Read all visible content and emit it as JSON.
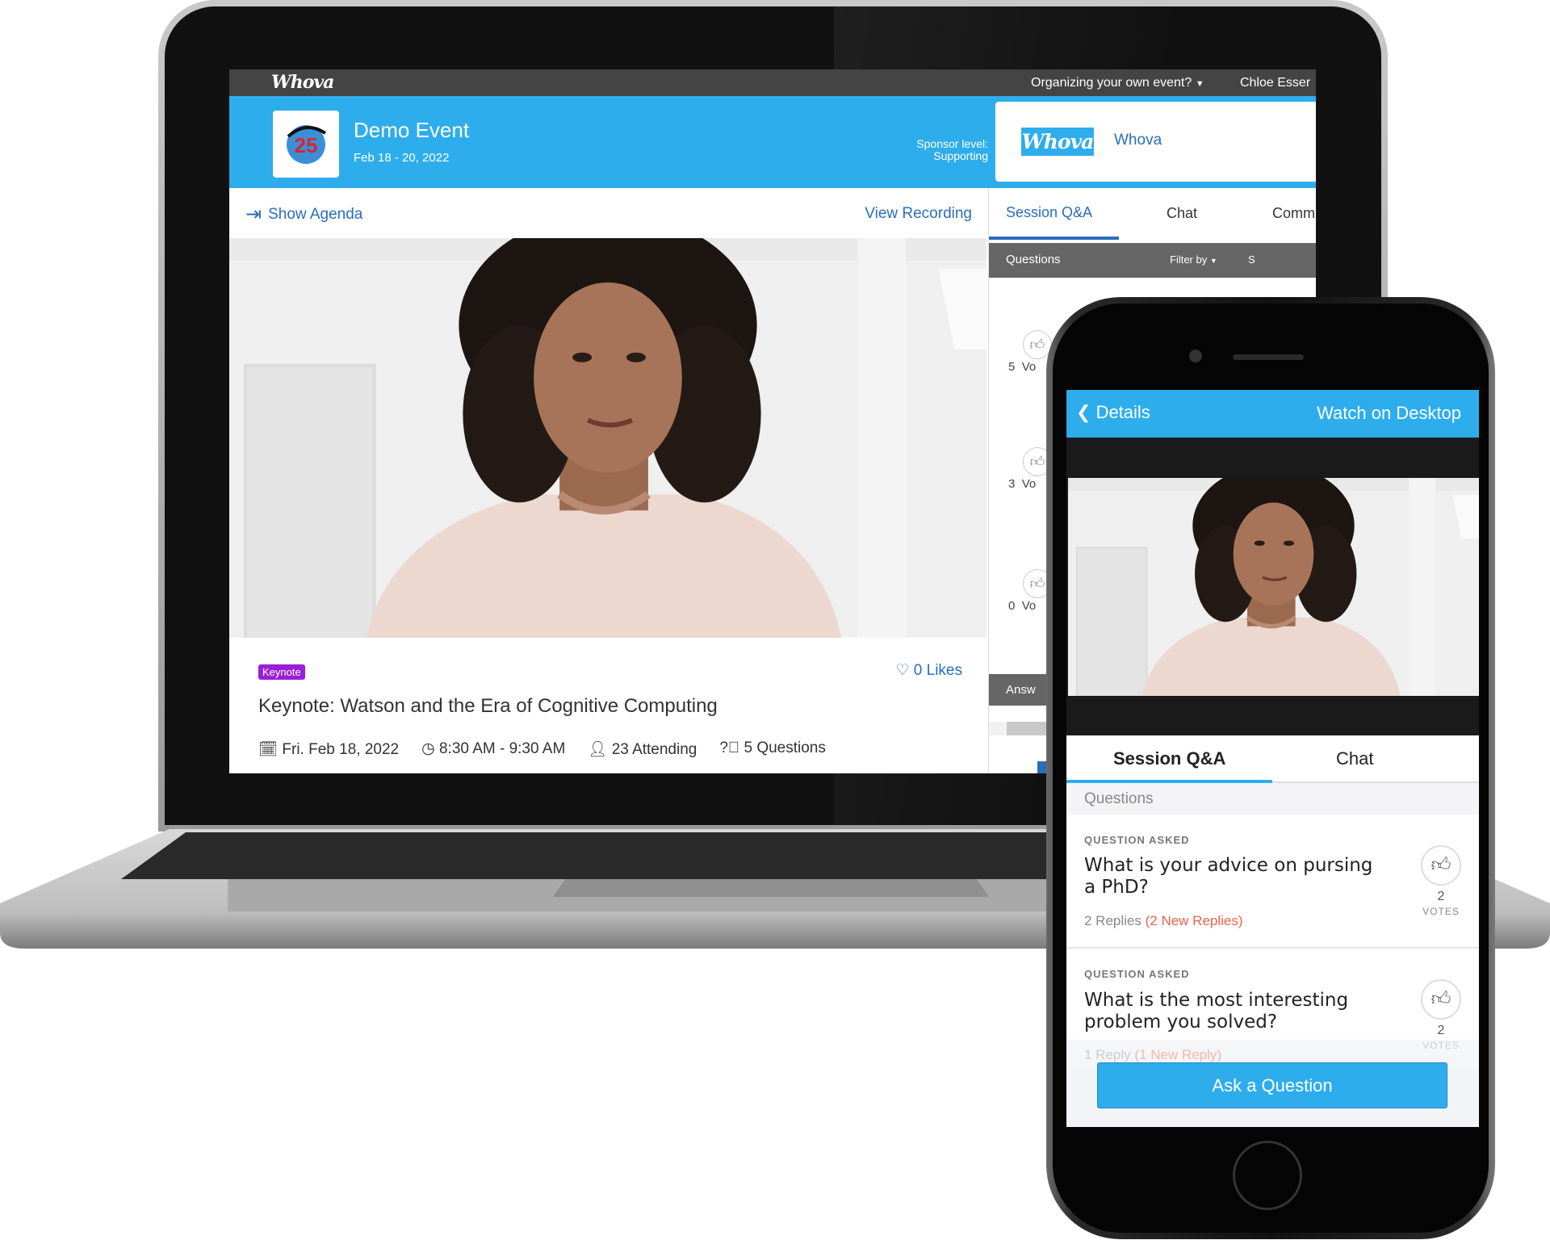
{
  "laptop": {
    "topbar": {
      "logo": "Whova",
      "organizing": "Organizing your own event?",
      "user": "Chloe Esser"
    },
    "header": {
      "event_title": "Demo Event",
      "event_dates": "Feb 18 - 20, 2022",
      "sponsor_label": "Sponsor level:",
      "sponsor_level": "Supporting",
      "sponsor_logo": "Whova",
      "sponsor_name": "Whova"
    },
    "nav": {
      "show_agenda": "Show Agenda",
      "view_recording": "View Recording"
    },
    "tabs": [
      {
        "label": "Session Q&A",
        "active": true
      },
      {
        "label": "Chat"
      },
      {
        "label": "Comm"
      }
    ],
    "questions_bar": {
      "title": "Questions",
      "filter": "Filter by",
      "extra": "S"
    },
    "votes": [
      {
        "count": "5",
        "label": "Vo"
      },
      {
        "count": "3",
        "label": "Vo"
      },
      {
        "count": "0",
        "label": "Vo"
      }
    ],
    "answered_bar": "Answ",
    "session": {
      "badge": "Keynote",
      "likes": "0 Likes",
      "title": "Keynote: Watson and the Era of Cognitive Computing",
      "date": "Fri. Feb 18, 2022",
      "time": "8:30 AM - 9:30 AM",
      "attending": "23 Attending",
      "questions": "5 Questions"
    }
  },
  "phone": {
    "back_label": "Details",
    "watch_desktop": "Watch on Desktop",
    "tabs": [
      {
        "label": "Session Q&A",
        "active": true
      },
      {
        "label": "Chat"
      }
    ],
    "section": "Questions",
    "questions": [
      {
        "label": "QUESTION ASKED",
        "text_line1": "What is your advice on pursing",
        "text_line2": "a PhD?",
        "replies": "2 Replies",
        "new_replies": "(2 New Replies)",
        "votes": "2",
        "votes_label": "VOTES"
      },
      {
        "label": "QUESTION ASKED",
        "text_line1": "What is the most interesting",
        "text_line2": "problem you solved?",
        "replies": "1 Reply",
        "new_replies": "(1 New Reply)",
        "votes": "2",
        "votes_label": "VOTES"
      }
    ],
    "ask_button": "Ask a Question"
  },
  "colors": {
    "brand_blue": "#2eadec",
    "link_blue": "#2a6ebb",
    "keynote_purple": "#9b1fd6",
    "new_reply_red": "#f0614e"
  }
}
